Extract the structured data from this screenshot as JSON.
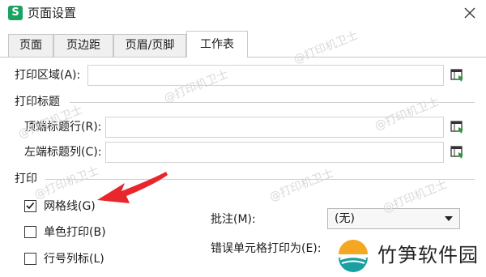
{
  "window": {
    "title": "页面设置",
    "app_icon_letter": "S",
    "app_icon_color": "#1aa260"
  },
  "tabs": [
    {
      "label": "页面",
      "active": false
    },
    {
      "label": "页边距",
      "active": false
    },
    {
      "label": "页眉/页脚",
      "active": false
    },
    {
      "label": "工作表",
      "active": true
    }
  ],
  "print_area": {
    "label": "打印区域(A):",
    "value": ""
  },
  "print_titles": {
    "section_label": "打印标题",
    "top_rows_label": "顶端标题行(R):",
    "top_rows_value": "",
    "left_cols_label": "左端标题列(C):",
    "left_cols_value": ""
  },
  "print": {
    "section_label": "打印",
    "gridlines": {
      "label": "网格线(G)",
      "checked": true
    },
    "monochrome": {
      "label": "单色打印(B)",
      "checked": false
    },
    "row_col_headings": {
      "label": "行号列标(L)",
      "checked": false
    },
    "comments_label": "批注(M):",
    "comments_value": "(无)",
    "errors_label": "错误单元格打印为(E):"
  },
  "watermark_text": "@打印机卫士",
  "logo": {
    "text": "竹笋软件园",
    "accent_top": "#f5a623",
    "accent_bottom": "#1aa0a0"
  },
  "annotation_color": "#e8262b"
}
